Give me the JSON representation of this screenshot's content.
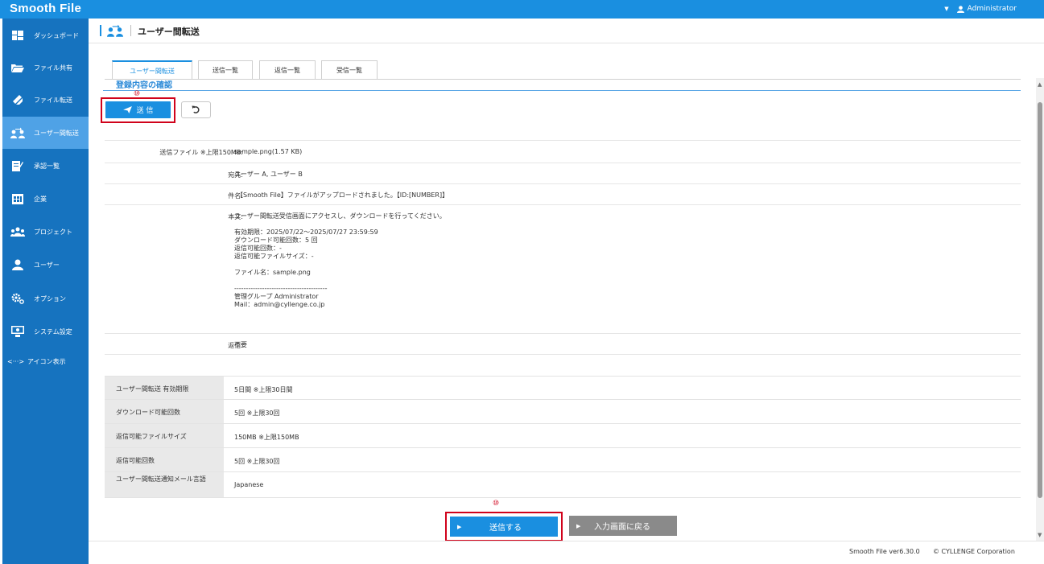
{
  "app": {
    "brand": "Smooth File",
    "user": "Administrator"
  },
  "sidebar": {
    "items": [
      {
        "label": "ダッシュボード",
        "icon": "dashboard-icon"
      },
      {
        "label": "ファイル共有",
        "icon": "folder-icon"
      },
      {
        "label": "ファイル転送",
        "icon": "transfer-icon"
      },
      {
        "label": "ユーザー間転送",
        "icon": "user-transfer-icon",
        "active": true
      },
      {
        "label": "承認一覧",
        "icon": "approval-icon"
      },
      {
        "label": "企業",
        "icon": "company-icon"
      },
      {
        "label": "プロジェクト",
        "icon": "project-icon"
      },
      {
        "label": "ユーザー",
        "icon": "user-icon"
      },
      {
        "label": "オプション",
        "icon": "options-gear-icon"
      },
      {
        "label": "システム設定",
        "icon": "system-settings-icon"
      }
    ],
    "icon_toggle": {
      "glyph": "<···>",
      "label": "アイコン表示"
    }
  },
  "header": {
    "title": "ユーザー間転送"
  },
  "tabs": [
    {
      "label": "ユーザー間転送",
      "active": true
    },
    {
      "label": "送信一覧"
    },
    {
      "label": "返信一覧"
    },
    {
      "label": "受信一覧"
    }
  ],
  "confirm": {
    "heading": "登録内容の確認",
    "step_mark": "⑩",
    "send_label": "送 信"
  },
  "details": [
    {
      "label": "送信ファイル ※上限150MB:",
      "value": "sample.png(1.57 KB)"
    },
    {
      "label": "宛先:",
      "value": "ユーザー A, ユーザー B"
    },
    {
      "label": "件名:",
      "value": "【Smooth File】ファイルがアップロードされました。【ID:[NUMBER]】"
    },
    {
      "label": "本文:",
      "value": "ユーザー間転送受信画面にアクセスし、ダウンロードを行ってください。\n\n有効期限：2025/07/22～2025/07/27 23:59:59\nダウンロード可能回数：5 回\n返信可能回数：-\n返信可能ファイルサイズ：-\n\nファイル名：sample.png\n\n----------------------------------------\n管理グループ Administrator\nMail：admin@cyllenge.co.jp"
    },
    {
      "label": "返信:",
      "value": "不要"
    }
  ],
  "settings": [
    {
      "label": "ユーザー間転送 有効期限",
      "value": "5日間 ※上限30日間"
    },
    {
      "label": "ダウンロード可能回数",
      "value": "5回 ※上限30回"
    },
    {
      "label": "返信可能ファイルサイズ",
      "value": "150MB ※上限150MB"
    },
    {
      "label": "返信可能回数",
      "value": "5回 ※上限30回"
    },
    {
      "label": "ユーザー間転送通知メール言語",
      "value": "Japanese"
    }
  ],
  "actions": {
    "step_mark": "⑩",
    "send_label": "送信する",
    "back_label": "入力画面に戻る"
  },
  "footer": {
    "version": "Smooth File ver6.30.0",
    "copyright": "© CYLLENGE Corporation"
  },
  "colors": {
    "primary": "#1a8fe0",
    "sidebar": "#1673bf",
    "sidebar_active": "#4fa2e6",
    "highlight": "#d0021b",
    "secondary_button": "#8a8a8a"
  }
}
